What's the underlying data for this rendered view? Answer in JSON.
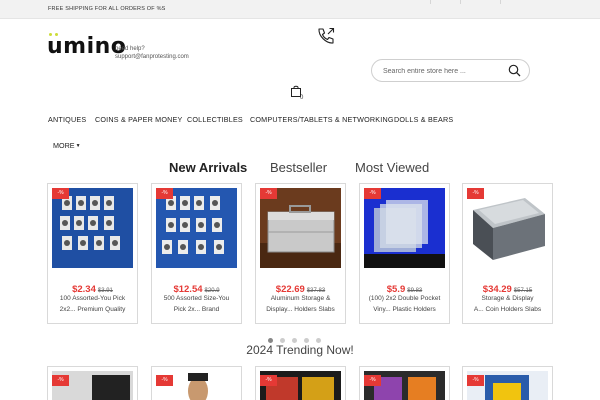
{
  "topbar": {
    "promo_text": "FREE SHIPPING FOR ALL ORDERS OF %S"
  },
  "header": {
    "logo_text": "umino",
    "help_label": "need help?",
    "help_email": "support@fanprotesting.com",
    "phone_icon": "phone-icon",
    "cart_count": "0"
  },
  "search": {
    "placeholder": "Search entire store here ...",
    "value": ""
  },
  "nav": {
    "items": [
      "ANTIQUES",
      "COINS & PAPER MONEY",
      "COLLECTIBLES",
      "COMPUTERS/TABLETS & NETWORKING",
      "DOLLS & BEARS"
    ],
    "more_label": "MORE"
  },
  "tabs": [
    {
      "label": "New Arrivals",
      "active": true
    },
    {
      "label": "Bestseller",
      "active": false
    },
    {
      "label": "Most Viewed",
      "active": false
    }
  ],
  "products": [
    {
      "badge": "-%",
      "price": "$2.34",
      "old_price": "$3.91",
      "title_line1": "100 Assorted-You Pick",
      "title_line2": "2x2...  Premium Quality"
    },
    {
      "badge": "-%",
      "price": "$12.54",
      "old_price": "$20.9",
      "title_line1": "500 Assorted Size-You",
      "title_line2": "Pick 2x...  Brand"
    },
    {
      "badge": "-%",
      "price": "$22.69",
      "old_price": "$37.83",
      "title_line1": "Aluminum Storage &",
      "title_line2": "Display...  Holders Slabs"
    },
    {
      "badge": "-%",
      "price": "$5.9",
      "old_price": "$9.83",
      "title_line1": "(100) 2x2 Double Pocket",
      "title_line2": "Viny...  Plastic Holders"
    },
    {
      "badge": "-%",
      "price": "$34.29",
      "old_price": "$57.15",
      "title_line1": "Storage & Display",
      "title_line2": "A...  Coin Holders Slabs"
    }
  ],
  "carousel": {
    "dots": 5,
    "active_dot": 1
  },
  "trending": {
    "title": "2024 Trending Now!",
    "badges": [
      "-%",
      "-%",
      "-%",
      "-%",
      "-%"
    ]
  },
  "colors": {
    "sale_red": "#e53935",
    "logo_accent": "#cddc39"
  }
}
